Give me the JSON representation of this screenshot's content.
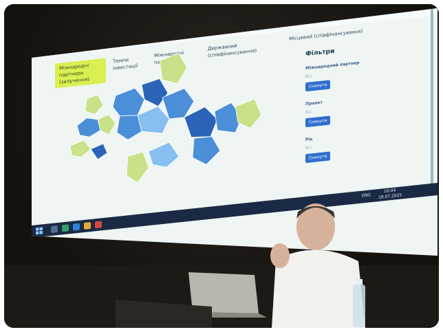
{
  "browser": {
    "tabs": [
      "",
      "",
      "",
      "",
      ""
    ],
    "address": ""
  },
  "dashboard": {
    "nav_tabs": [
      {
        "label": "Міжнародні партнери (залучення)",
        "active": true
      },
      {
        "label": "Темпи інвестиції",
        "active": false
      },
      {
        "label": "Міжнародні партнери",
        "active": false
      },
      {
        "label": "Державний (співфінансування)",
        "active": false
      },
      {
        "label": "Місцевий (співфінансування)",
        "active": false
      }
    ],
    "filters": {
      "title": "Фільтри",
      "groups": [
        {
          "label": "Міжнародний партнер",
          "value": "Всі",
          "button": "Скинути"
        },
        {
          "label": "Проект",
          "value": "Всі",
          "button": "Скинути"
        },
        {
          "label": "Рік",
          "value": "Всі",
          "button": "Скинути"
        }
      ]
    }
  },
  "taskbar": {
    "language": "ENG",
    "time": "16:04",
    "date": "18.07.2025"
  },
  "colors": {
    "projection_bg": "#eef5f3",
    "map_dark_blue": "#2a63b8",
    "map_mid_blue": "#4a8fd8",
    "map_light_blue": "#86bff0",
    "map_pale_green": "#c9e28a",
    "accent_lime": "#d9ef52",
    "button_blue": "#2f6fd0"
  },
  "icons": [
    "search-icon",
    "star-icon",
    "download-icon",
    "profile-icon",
    "windows-start-icon"
  ]
}
